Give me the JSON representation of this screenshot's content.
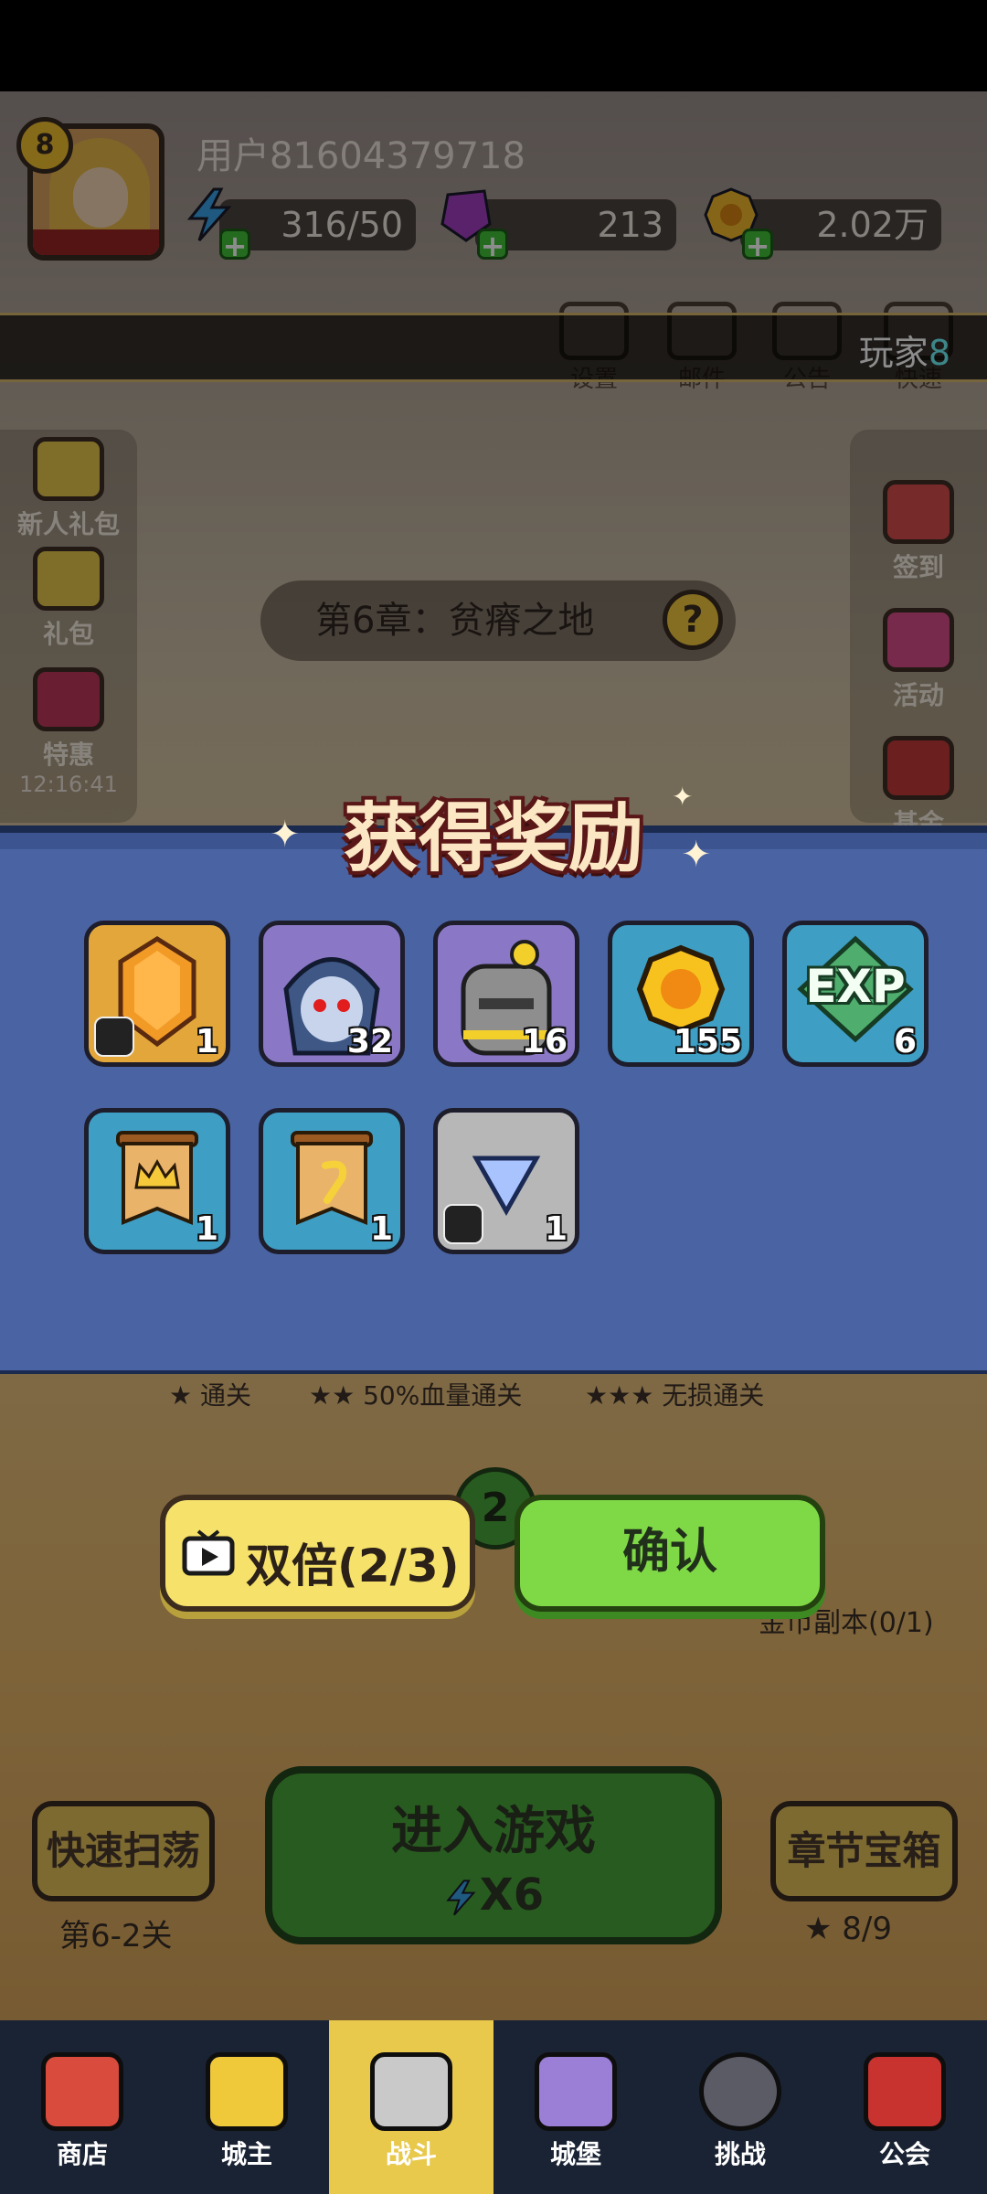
{
  "profile": {
    "level": "8",
    "username": "用户81604379718",
    "energy": "316/50",
    "gems": "213",
    "gold": "2.02万"
  },
  "notice": {
    "prefix": "玩家",
    "highlight": "8"
  },
  "top_menu": [
    "设置",
    "邮件",
    "公告",
    "快速"
  ],
  "left_menu": [
    {
      "label": "新人礼包"
    },
    {
      "label": "礼包"
    },
    {
      "label": "特惠",
      "timer": "12:16:41"
    }
  ],
  "right_menu": [
    {
      "label": "签到"
    },
    {
      "label": "活动"
    },
    {
      "label": "基金"
    }
  ],
  "chapter": {
    "title": "第6章：贫瘠之地",
    "help": "?"
  },
  "stars_conditions": [
    "通关",
    "50%血量通关",
    "无损通关"
  ],
  "stage_number": "2",
  "gold_dungeon": "金币副本(0/1)",
  "reward_modal": {
    "title": "获得奖励",
    "items": [
      {
        "icon": "gold-crystal-icon",
        "count": "1",
        "tint": "gold"
      },
      {
        "icon": "knight-hero-icon",
        "count": "32",
        "tint": "purple"
      },
      {
        "icon": "golem-hero-icon",
        "count": "16",
        "tint": "purple"
      },
      {
        "icon": "gold-coin-icon",
        "count": "155",
        "tint": "blue"
      },
      {
        "icon": "exp-icon",
        "label": "EXP",
        "count": "6",
        "tint": "blue"
      },
      {
        "icon": "crown-scroll-icon",
        "count": "1",
        "tint": "blue"
      },
      {
        "icon": "rune-scroll-icon",
        "count": "1",
        "tint": "blue"
      },
      {
        "icon": "blue-gem-icon",
        "count": "1",
        "tint": "gray"
      }
    ],
    "double_label": "双倍(2/3)",
    "confirm_label": "确认"
  },
  "actions": {
    "sweep": "快速扫荡",
    "sweep_stage": "第6-2关",
    "enter": "进入游戏",
    "energy_cost": "X6",
    "chest": "章节宝箱",
    "chest_stars": "8/9"
  },
  "nav": [
    {
      "label": "商店"
    },
    {
      "label": "城主"
    },
    {
      "label": "战斗"
    },
    {
      "label": "城堡"
    },
    {
      "label": "挑战"
    },
    {
      "label": "公会"
    }
  ],
  "colors": {
    "modal_bg": "#4a63a2",
    "double_btn": "#f6e16a",
    "confirm_btn": "#7fd947",
    "nav_bg": "#1a2333",
    "nav_active": "#e8c94c"
  }
}
